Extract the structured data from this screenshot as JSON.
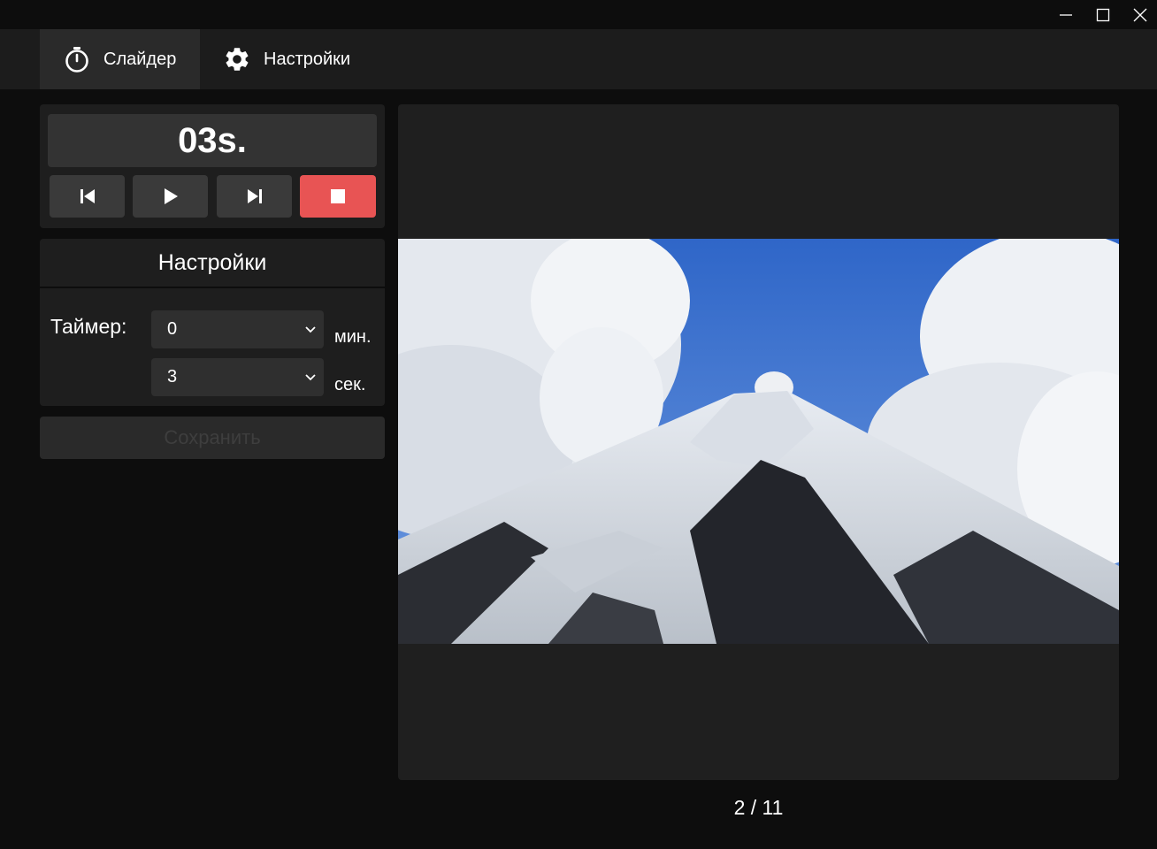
{
  "window": {
    "controls": [
      "minimize-icon",
      "maximize-icon",
      "close-icon"
    ]
  },
  "nav": {
    "tabs": [
      {
        "label": "Слайдер",
        "icon": "stopwatch-icon",
        "active": true
      },
      {
        "label": "Настройки",
        "icon": "gear-icon",
        "active": false
      }
    ]
  },
  "timer": {
    "display": "03s.",
    "controls": {
      "prev_icon": "skip-previous-icon",
      "play_icon": "play-icon",
      "next_icon": "skip-next-icon",
      "stop_icon": "stop-icon"
    },
    "stop_color": "#e85454"
  },
  "settings": {
    "title": "Настройки",
    "timer_label": "Таймер:",
    "minutes": {
      "value": "0",
      "unit": "мин."
    },
    "seconds": {
      "value": "3",
      "unit": "сек."
    }
  },
  "save_button": {
    "label": "Сохранить",
    "disabled": true
  },
  "viewer": {
    "image": "snow-capped-volcano-photo",
    "counter": "2 / 11"
  }
}
